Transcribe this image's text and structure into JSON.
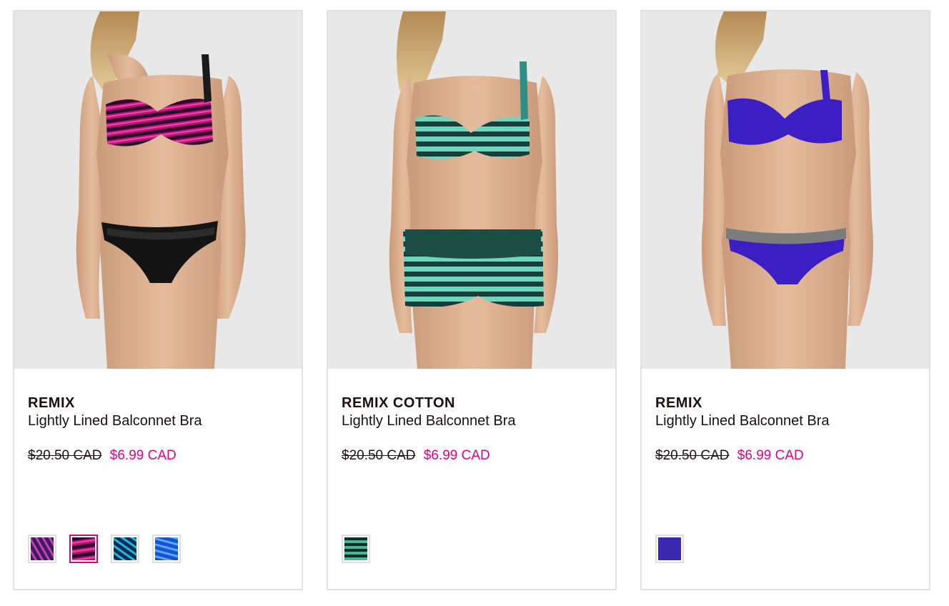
{
  "products": [
    {
      "brand": "REMIX",
      "name": "Lightly Lined Balconnet Bra",
      "was_price": "$20.50 CAD",
      "price": "$6.99 CAD",
      "image_alt": "Model wearing pink striped balconnet bra with black lace panty",
      "swatches": [
        "purple-floral",
        "pink-stripe",
        "teal-print",
        "blue-stripe"
      ],
      "selected_swatch": 1
    },
    {
      "brand": "REMIX COTTON",
      "name": "Lightly Lined Balconnet Bra",
      "was_price": "$20.50 CAD",
      "price": "$6.99 CAD",
      "image_alt": "Model wearing teal striped balconnet bra with matching boyshort",
      "swatches": [
        "green-stripe"
      ],
      "selected_swatch": -1
    },
    {
      "brand": "REMIX",
      "name": "Lightly Lined Balconnet Bra",
      "was_price": "$20.50 CAD",
      "price": "$6.99 CAD",
      "image_alt": "Model wearing cobalt blue balconnet bra with matching bikini",
      "swatches": [
        "cobalt-solid"
      ],
      "selected_swatch": -1
    }
  ],
  "colors": {
    "sale_price": "#e0007f",
    "text": "#1e0f0f",
    "card_border": "#e1e1e1",
    "photo_bg": "#e8e8e8"
  }
}
